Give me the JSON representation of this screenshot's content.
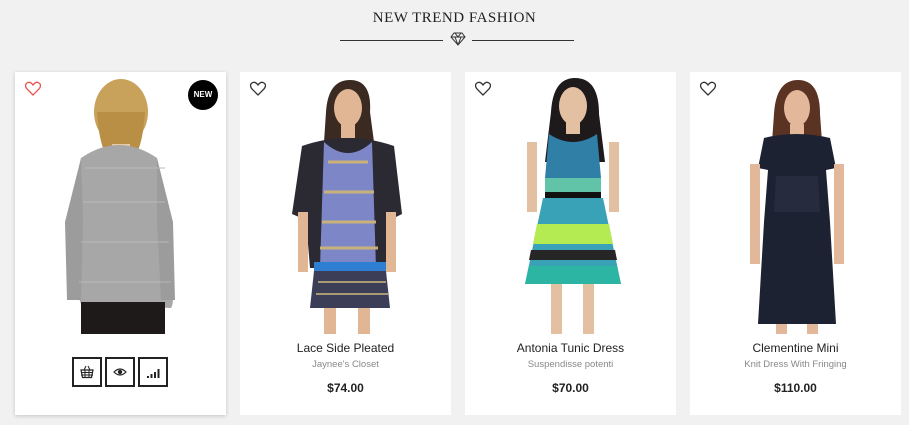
{
  "section": {
    "title": "NEW TREND FASHION"
  },
  "card_actions": {
    "cart_icon": "basket-icon",
    "view_icon": "eye-icon",
    "compare_icon": "signal-bars-icon"
  },
  "colors": {
    "background": "#f1f1f1",
    "card": "#ffffff",
    "heart_active": "#e8534f",
    "text": "#222222",
    "muted": "#888888"
  },
  "products": [
    {
      "name": "",
      "brand": "",
      "price": "",
      "badge": "NEW",
      "wishlist_icon": "heart-icon"
    },
    {
      "name": "Lace Side Pleated",
      "brand": "Jaynee's Closet",
      "price": "$74.00",
      "wishlist_icon": "heart-icon"
    },
    {
      "name": "Antonia Tunic Dress",
      "brand": "Suspendisse potenti",
      "price": "$70.00",
      "wishlist_icon": "heart-icon"
    },
    {
      "name": "Clementine Mini",
      "brand": "Knit Dress With Fringing",
      "price": "$110.00",
      "wishlist_icon": "heart-icon"
    }
  ]
}
